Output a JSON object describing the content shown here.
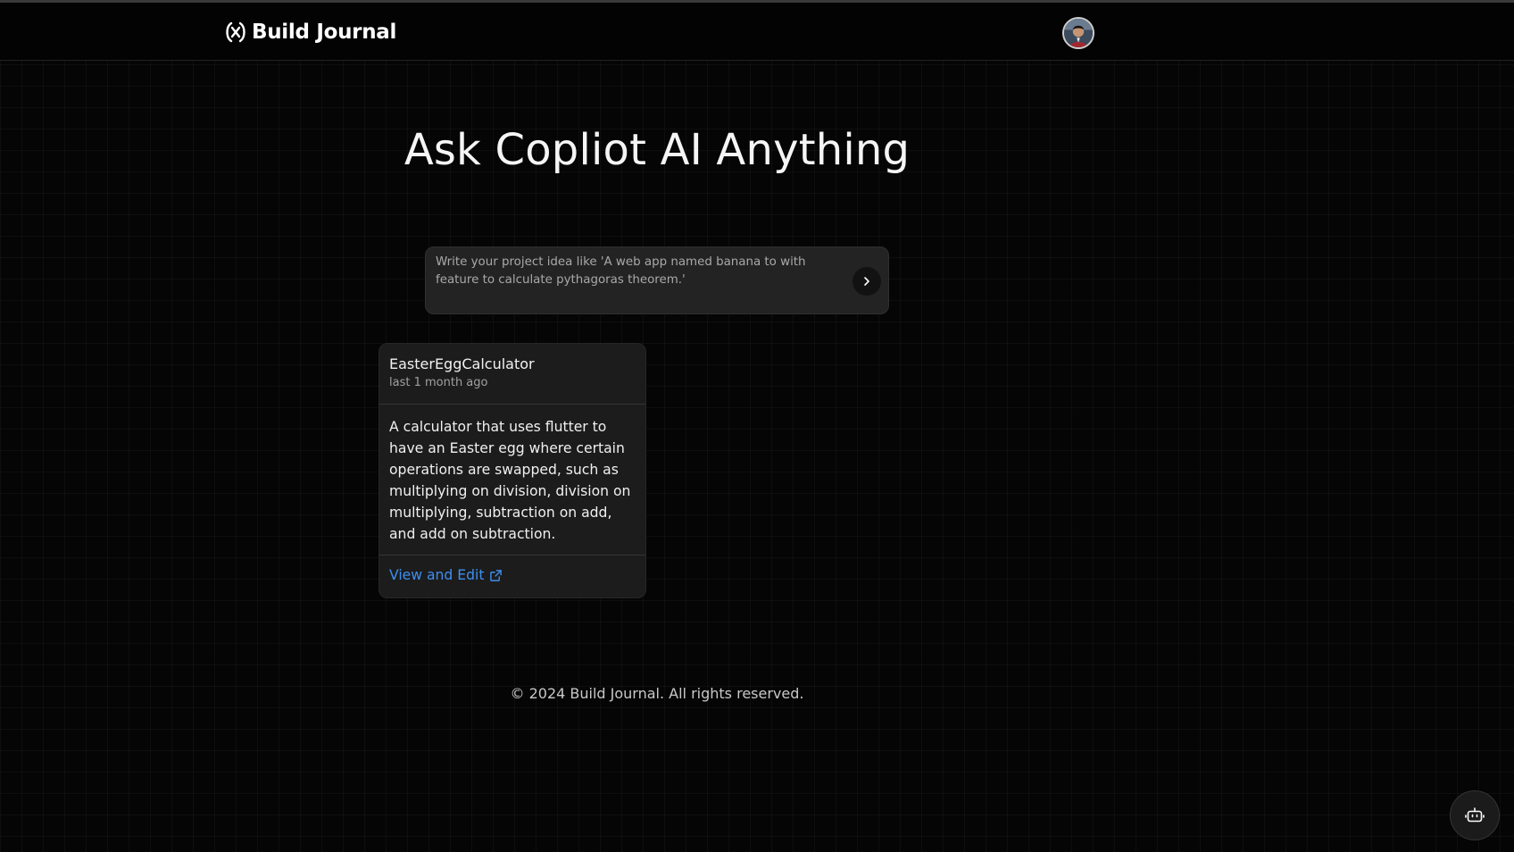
{
  "header": {
    "logo_text": "Build Journal",
    "avatar_alt": "User avatar"
  },
  "hero": {
    "title": "Ask Copliot AI Anything"
  },
  "prompt": {
    "placeholder": "Write your project idea like 'A web app named banana to with feature to calculate pythagoras theorem.'",
    "value": "",
    "send_icon": "chevron-right-icon"
  },
  "projects": [
    {
      "title": "EasterEggCalculator",
      "updated": "last 1 month ago",
      "description": "A calculator that uses flutter to have an Easter egg where certain operations are swapped, such as multiplying on division, division on multiplying, subtraction on add, and add on subtraction.",
      "link_label": "View and Edit",
      "link_icon": "external-link-icon"
    }
  ],
  "footer": {
    "copyright": "© 2024 Build Journal. All rights reserved."
  },
  "chat_fab": {
    "icon": "bot-icon"
  },
  "colors": {
    "background": "#050505",
    "card": "#1c1c1c",
    "input": "#232323",
    "link": "#3d8ff0"
  }
}
